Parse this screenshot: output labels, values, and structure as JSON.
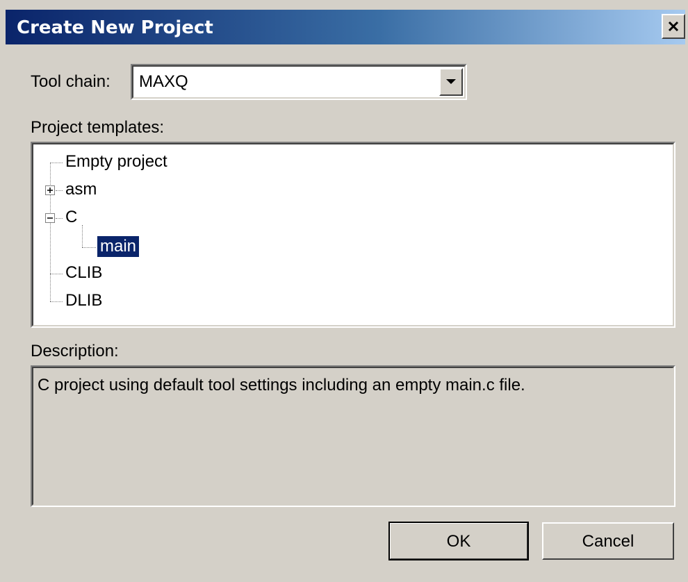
{
  "window": {
    "title": "Create New Project",
    "close_icon": "close-icon"
  },
  "toolchain": {
    "label": "Tool chain:",
    "value": "MAXQ",
    "dropdown_icon": "chevron-down-icon"
  },
  "templates": {
    "label": "Project templates:",
    "items": [
      {
        "label": "Empty project",
        "type": "leaf"
      },
      {
        "label": "asm",
        "type": "collapsed"
      },
      {
        "label": "C",
        "type": "expanded"
      },
      {
        "label": "main",
        "type": "leaf",
        "selected": true,
        "parent": "C"
      },
      {
        "label": "CLIB",
        "type": "leaf"
      },
      {
        "label": "DLIB",
        "type": "leaf"
      }
    ]
  },
  "description": {
    "label": "Description:",
    "text": "C project using default tool settings including an empty main.c file."
  },
  "buttons": {
    "ok": "OK",
    "cancel": "Cancel"
  },
  "colors": {
    "titlebar_start": "#0a246a",
    "titlebar_end": "#a6caf0",
    "dialog_bg": "#d4d0c8",
    "selection": "#0a246a"
  }
}
